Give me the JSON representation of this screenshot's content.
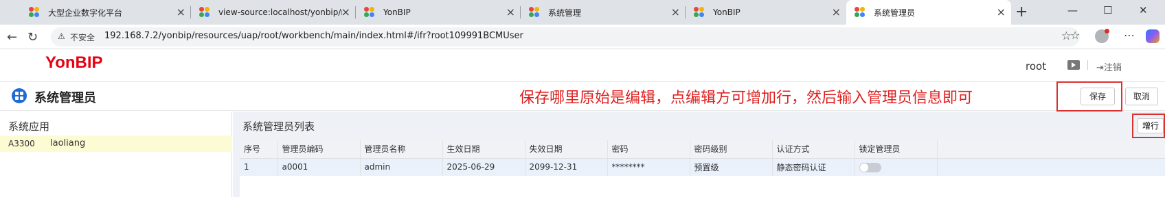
{
  "browser": {
    "tabs": [
      {
        "title": "大型企业数字化平台"
      },
      {
        "title": "view-source:localhost/yonbip/res"
      },
      {
        "title": "YonBIP"
      },
      {
        "title": "系统管理"
      },
      {
        "title": "YonBIP"
      },
      {
        "title": "系统管理员"
      }
    ],
    "insecure_label": "不安全",
    "url": "192.168.7.2/yonbip/resources/uap/root/workbench/main/index.html#/ifr?root109991BCMUser"
  },
  "app": {
    "logo": "YonBIP",
    "user": "root",
    "logout_label": "注销"
  },
  "page": {
    "title": "系统管理员",
    "annotation": "保存哪里原始是编辑，点编辑方可增加行，然后输入管理员信息即可",
    "save_label": "保存",
    "cancel_label": "取消"
  },
  "left_panel": {
    "title": "系统应用",
    "items": [
      {
        "code": "A3300",
        "name": "laoliang"
      }
    ]
  },
  "right_panel": {
    "title": "系统管理员列表",
    "add_row_label": "增行",
    "columns": [
      "序号",
      "管理员编码",
      "管理员名称",
      "生效日期",
      "失效日期",
      "密码",
      "密码级别",
      "认证方式",
      "锁定管理员"
    ],
    "rows": [
      [
        "1",
        "a0001",
        "admin",
        "2025-06-29",
        "2099-12-31",
        "********",
        "预置级",
        "静态密码认证",
        ""
      ]
    ]
  }
}
